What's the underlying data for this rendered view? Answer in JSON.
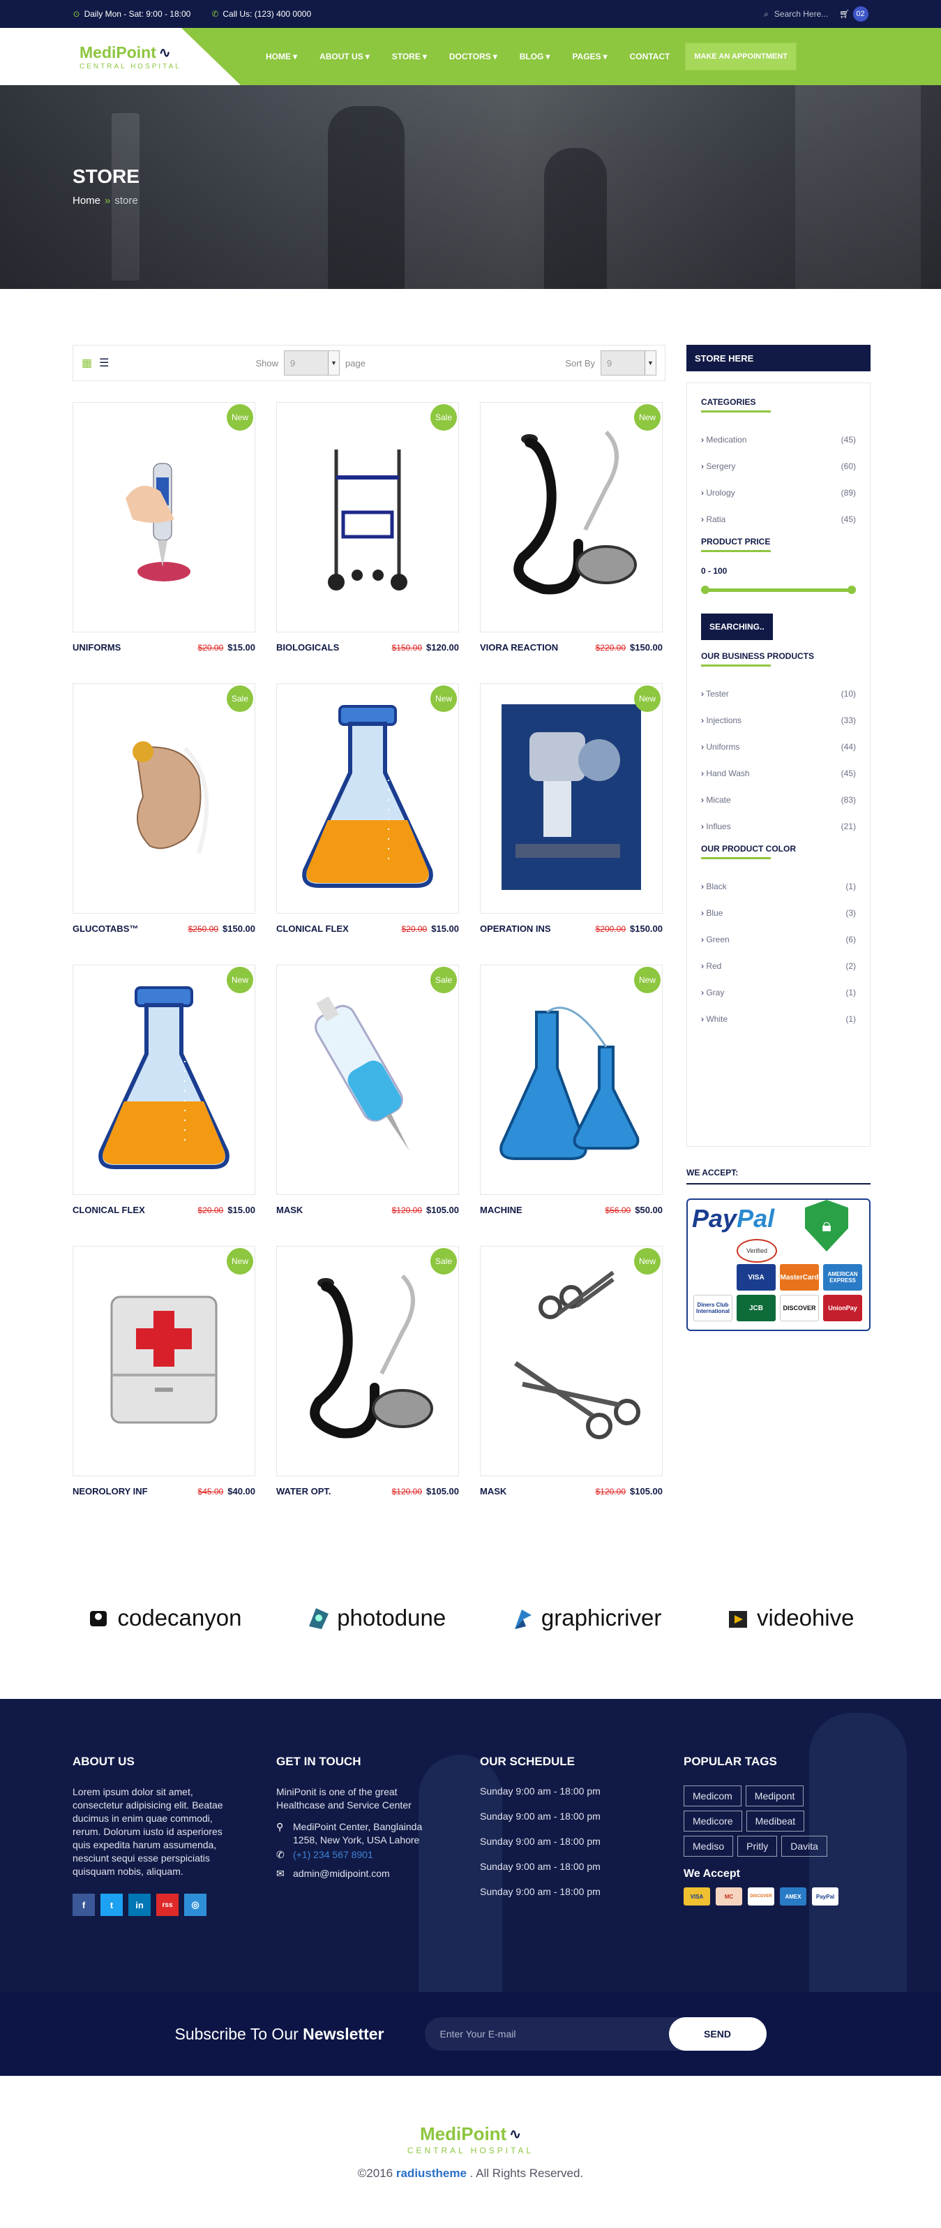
{
  "topbar": {
    "hours": "Daily Mon - Sat: 9:00 - 18:00",
    "call": "Call Us: (123) 400 0000",
    "search_placeholder": "Search Here...",
    "cart_count": "02"
  },
  "logo": {
    "name": "MediPoint",
    "sub": "CENTRAL HOSPITAL"
  },
  "nav": {
    "items": [
      "HOME",
      "ABOUT US",
      "STORE",
      "DOCTORS",
      "BLOG",
      "PAGES",
      "CONTACT"
    ],
    "cta": "MAKE AN APPOINTMENT"
  },
  "banner": {
    "title": "STORE",
    "crumb_home": "Home",
    "crumb_sep": "»",
    "crumb_current": "store"
  },
  "toolbar": {
    "show_label": "Show",
    "show_value": "9",
    "page_label": "page",
    "sort_label": "Sort By",
    "sort_value": "9"
  },
  "products": [
    {
      "name": "UNIFORMS",
      "old": "$20.00",
      "price": "$15.00",
      "tag": "New",
      "icon": "pipette-icon"
    },
    {
      "name": "BIOLOGICALS",
      "old": "$150.00",
      "price": "$120.00",
      "tag": "Sale",
      "icon": "walker-icon"
    },
    {
      "name": "VIORA REACTION",
      "old": "$220.00",
      "price": "$150.00",
      "tag": "New",
      "icon": "stethoscope-icon"
    },
    {
      "name": "GLUCOTABS™",
      "old": "$250.00",
      "price": "$150.00",
      "tag": "Sale",
      "icon": "hearing-aid-icon"
    },
    {
      "name": "CLONICAL FLEX",
      "old": "$20.00",
      "price": "$15.00",
      "tag": "New",
      "icon": "flask-icon"
    },
    {
      "name": "OPERATION INS",
      "old": "$200.00",
      "price": "$150.00",
      "tag": "New",
      "icon": "microscope-icon"
    },
    {
      "name": "CLONICAL FLEX",
      "old": "$20.00",
      "price": "$15.00",
      "tag": "New",
      "icon": "flask-icon"
    },
    {
      "name": "MASK",
      "old": "$120.00",
      "price": "$105.00",
      "tag": "Sale",
      "icon": "syringe-icon"
    },
    {
      "name": "MACHINE",
      "old": "$56.00",
      "price": "$50.00",
      "tag": "New",
      "icon": "lab-flasks-icon"
    },
    {
      "name": "NEOROLORY INF",
      "old": "$45.00",
      "price": "$40.00",
      "tag": "New",
      "icon": "first-aid-kit-icon"
    },
    {
      "name": "WATER OPT.",
      "old": "$120.00",
      "price": "$105.00",
      "tag": "Sale",
      "icon": "stethoscope-icon"
    },
    {
      "name": "MASK",
      "old": "$120.00",
      "price": "$105.00",
      "tag": "New",
      "icon": "surgical-scissors-icon"
    }
  ],
  "sidebar": {
    "header": "STORE HERE",
    "categories_title": "CATEGORIES",
    "categories": [
      {
        "label": "Medication",
        "count": "(45)"
      },
      {
        "label": "Sergery",
        "count": "(60)"
      },
      {
        "label": "Urology",
        "count": "(89)"
      },
      {
        "label": "Ratia",
        "count": "(45)"
      }
    ],
    "price_title": "PRODUCT PRICE",
    "price_range": "0 - 100",
    "search_button": "SEARCHING..",
    "business_title": "OUR BUSINESS PRODUCTS",
    "business": [
      {
        "label": "Tester",
        "count": "(10)"
      },
      {
        "label": "Injections",
        "count": "(33)"
      },
      {
        "label": "Uniforms",
        "count": "(44)"
      },
      {
        "label": "Hand Wash",
        "count": "(45)"
      },
      {
        "label": "Micate",
        "count": "(83)"
      },
      {
        "label": "Influes",
        "count": "(21)"
      }
    ],
    "color_title": "OUR PRODUCT COLOR",
    "colors": [
      {
        "label": "Black",
        "count": "(1)"
      },
      {
        "label": "Blue",
        "count": "(3)"
      },
      {
        "label": "Green",
        "count": "(6)"
      },
      {
        "label": "Red",
        "count": "(2)"
      },
      {
        "label": "Gray",
        "count": "(1)"
      },
      {
        "label": "White",
        "count": "(1)"
      }
    ],
    "we_accept": "WE ACCEPT:",
    "paypal": {
      "pay": "Pay",
      "pal": "Pal",
      "verified": "Verified",
      "cards": [
        "VISA",
        "MasterCard",
        "AMERICAN EXPRESS",
        "Diners Club International",
        "JCB",
        "DISCOVER",
        "UnionPay"
      ]
    }
  },
  "brands": [
    "codecanyon",
    "photodune",
    "graphicriver",
    "videohive"
  ],
  "footer": {
    "about_title": "ABOUT US",
    "about_text": "Lorem ipsum dolor sit amet, consectetur adipisicing elit. Beatae ducimus in enim quae commodi, rerum. Dolorum iusto id asperiores quis expedita harum assumenda, nesciunt sequi esse perspiciatis quisquam nobis, aliquam.",
    "social": [
      "f",
      "t",
      "in",
      "rss",
      "◎"
    ],
    "touch_title": "GET IN TOUCH",
    "touch_text": "MiniPonit is one of the great Healthcase and Service Center",
    "address": "MediPoint Center, Banglainda 1258, New York, USA Lahore",
    "phone": "(+1) 234 567 8901",
    "email": "admin@midipoint.com",
    "schedule_title": "OUR SCHEDULE",
    "schedule": [
      "Sunday 9:00 am - 18:00 pm",
      "Sunday 9:00 am - 18:00 pm",
      "Sunday 9:00 am - 18:00 pm",
      "Sunday 9:00 am - 18:00 pm",
      "Sunday 9:00 am - 18:00 pm"
    ],
    "tags_title": "POPULAR TAGS",
    "tags": [
      "Medicom",
      "Medipont",
      "Medicore",
      "Medibeat",
      "Mediso",
      "Pritly",
      "Davita"
    ],
    "we_accept": "We Accept",
    "payments": [
      "VISA",
      "MC",
      "DISCOVER",
      "AMEX",
      "PayPal"
    ]
  },
  "newsletter": {
    "text_plain": "Subscribe To Our ",
    "text_bold": "Newsletter",
    "placeholder": "Enter Your E-mail",
    "button": "SEND"
  },
  "bottom": {
    "copyright_pre": "©2016 ",
    "brand": "radiustheme",
    "copyright_post": " . All Rights Reserved."
  },
  "colors": {
    "navy": "#111a46",
    "green": "#8dc63f",
    "sale_red": "#e02020"
  }
}
